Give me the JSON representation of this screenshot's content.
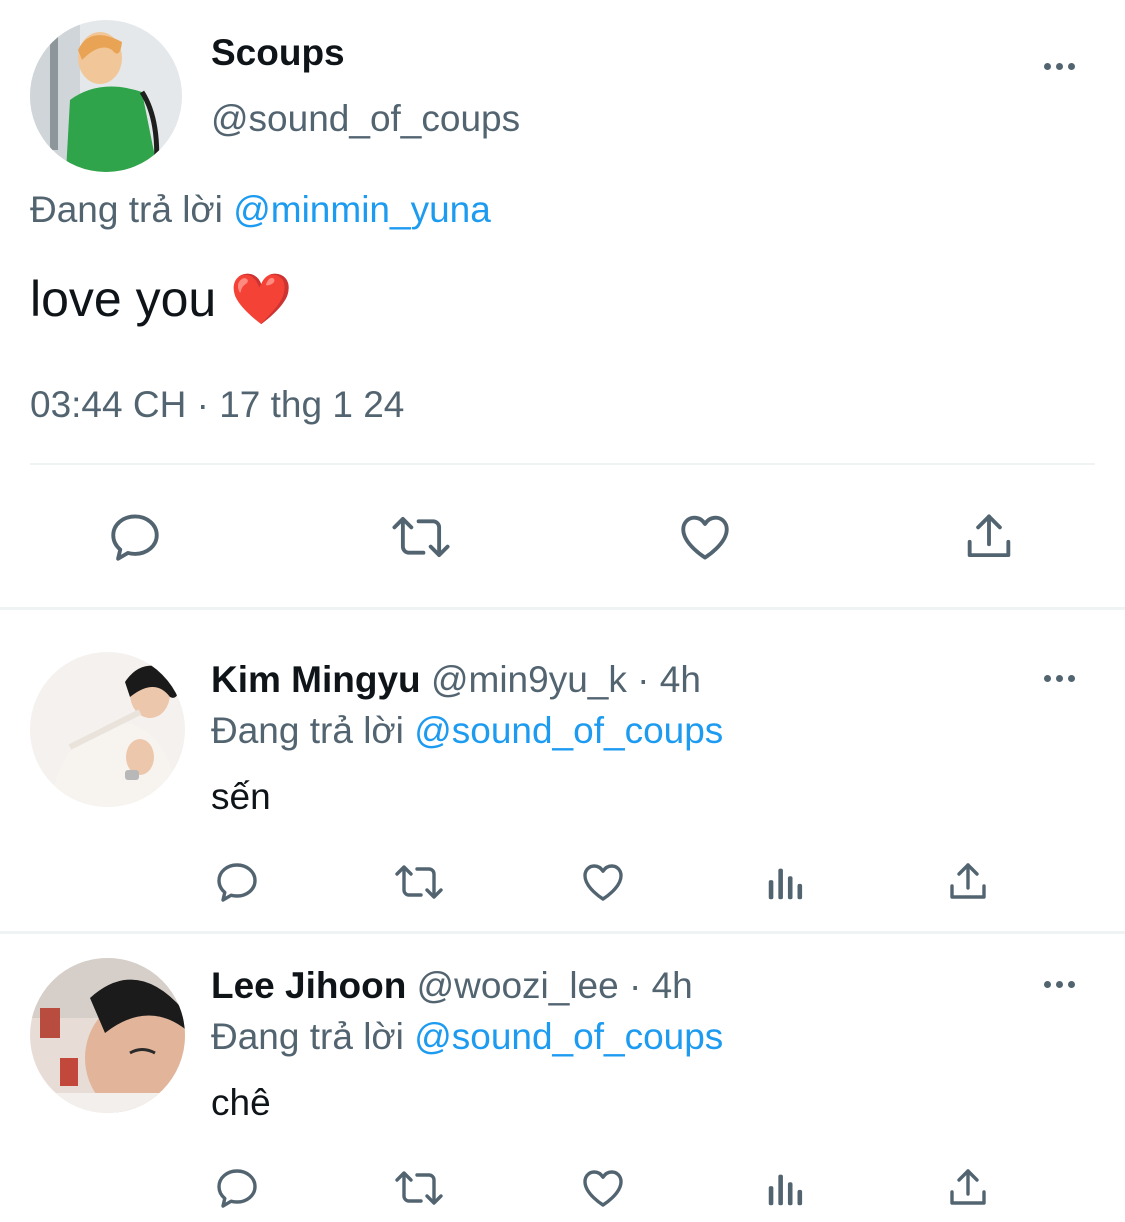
{
  "main_tweet": {
    "name": "Scoups",
    "handle": "@sound_of_coups",
    "reply_prefix": "Đang trả lời",
    "reply_to": "@minmin_yuna",
    "text": "love you ❤️",
    "timestamp": "03:44 CH · 17 thg 1 24",
    "actions": [
      "reply-icon",
      "retweet-icon",
      "like-icon",
      "share-icon"
    ]
  },
  "replies": [
    {
      "name": "Kim Mingyu",
      "handle": "@min9yu_k",
      "time": "· 4h",
      "reply_prefix": "Đang trả lời",
      "reply_to": "@sound_of_coups",
      "text": "sến"
    },
    {
      "name": "Lee Jihoon",
      "handle": "@woozi_lee",
      "time": "· 4h",
      "reply_prefix": "Đang trả lời",
      "reply_to": "@sound_of_coups",
      "text": "chê"
    }
  ],
  "colors": {
    "link": "#1d9bf0",
    "muted": "#536471",
    "text": "#0f1419",
    "heart": "#e0245e"
  }
}
